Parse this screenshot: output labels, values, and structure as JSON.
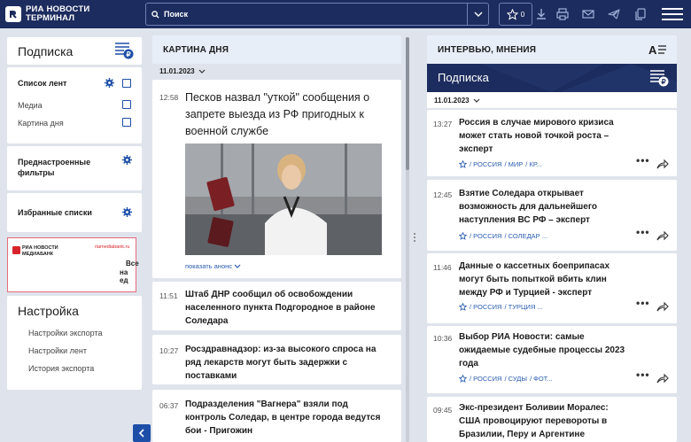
{
  "header": {
    "logo_line1": "РИА НОВОСТИ",
    "logo_line2": "ТЕРМИНАЛ",
    "search_placeholder": "Поиск",
    "favorites_count": "0",
    "colors": {
      "bar": "#1d2c5e",
      "accent": "#1e4fa8"
    },
    "icons": [
      "star-icon",
      "download-icon",
      "print-icon",
      "mail-icon",
      "telegram-icon",
      "copy-icon",
      "menu-icon"
    ]
  },
  "sidebar": {
    "subscription_title": "Подписка",
    "feeds_list_label": "Список лент",
    "feeds": [
      "Медиа",
      "Картина дня"
    ],
    "preset_filters_label": "Преднастроенные фильтры",
    "favorite_lists_label": "Избранные списки",
    "banner": {
      "logo_line1": "РИА НОВОСТИ",
      "logo_line2": "МЕДИАБАНК",
      "url": "riamediabank.ru",
      "text_line1": "Все",
      "text_line2": "на ед"
    },
    "settings_title": "Настройка",
    "settings_items": [
      "Настройки экспорта",
      "Настройки лент",
      "История экспорта"
    ]
  },
  "middle": {
    "header": "КАРТИНА ДНЯ",
    "date": "11.01.2023",
    "featured": {
      "time": "12:58",
      "headline": "Песков назвал \"уткой\" сообщения о запрете выезда из РФ пригодных к военной службе",
      "show_announce": "показать анонс"
    },
    "items": [
      {
        "time": "11:51",
        "headline": "Штаб ДНР сообщил об освобождении населенного пункта Подгородное в районе Соледара"
      },
      {
        "time": "10:27",
        "headline": "Росздравнадзор: из-за высокого спроса на ряд лекарств могут быть задержки с поставками"
      },
      {
        "time": "06:37",
        "headline": "Подразделения \"Вагнера\" взяли под контроль Соледар, в центре города ведутся бои - Пригожин"
      }
    ]
  },
  "right": {
    "header": "ИНТЕРВЬЮ, МНЕНИЯ",
    "subscription_title": "Подписка",
    "date": "11.01.2023",
    "items": [
      {
        "time": "13:27",
        "headline": "Россия в случае мирового кризиса может стать новой точкой роста – эксперт",
        "tags": [
          "/ РОССИЯ",
          "/ МИР",
          "/ КР..."
        ]
      },
      {
        "time": "12:45",
        "headline": "Взятие Соледара открывает возможность для дальнейшего наступления ВС РФ – эксперт",
        "tags": [
          "/ РОССИЯ",
          "/ СОЛЕДАР ..."
        ]
      },
      {
        "time": "11:46",
        "headline": "Данные о кассетных боеприпасах могут быть попыткой вбить клин между РФ и Турцией - эксперт",
        "tags": [
          "/ РОССИЯ",
          "/ ТУРЦИЯ ..."
        ]
      },
      {
        "time": "10:36",
        "headline": "Выбор РИА Новости: самые ожидаемые судебные процессы 2023 года",
        "tags": [
          "/ РОССИЯ",
          "/ СУДЫ",
          "/ ФОТ..."
        ]
      },
      {
        "time": "09:45",
        "headline": "Экс-президент Боливии Моралес: США провоцируют перевороты в Бразилии, Перу и Аргентине",
        "tags": []
      }
    ]
  }
}
